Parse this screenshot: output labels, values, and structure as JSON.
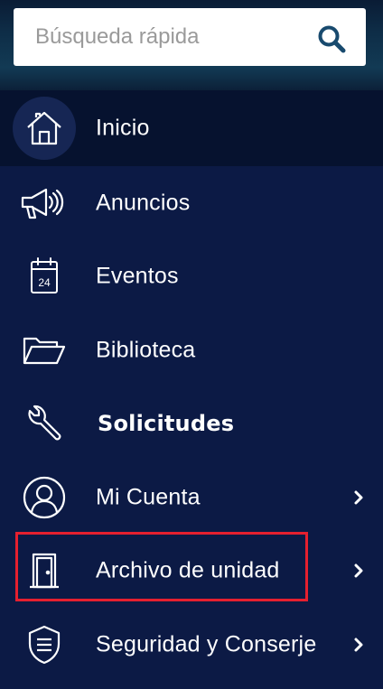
{
  "search": {
    "placeholder": "Búsqueda rápida",
    "icon": "search-icon"
  },
  "colors": {
    "background": "#0c1a45",
    "active_item": "#06122f",
    "search_icon": "#184a6e",
    "highlight_border": "#e6202f"
  },
  "menu": {
    "items": [
      {
        "label": "Inicio",
        "icon": "home-icon",
        "active": true,
        "has_submenu": false
      },
      {
        "label": "Anuncios",
        "icon": "megaphone-icon",
        "active": false,
        "has_submenu": false
      },
      {
        "label": "Eventos",
        "icon": "calendar-icon",
        "icon_text": "24",
        "active": false,
        "has_submenu": false
      },
      {
        "label": "Biblioteca",
        "icon": "folder-icon",
        "active": false,
        "has_submenu": false
      },
      {
        "label": "Solicitudes",
        "icon": "wrench-icon",
        "active": false,
        "has_submenu": false
      },
      {
        "label": "Mi Cuenta",
        "icon": "user-icon",
        "active": false,
        "has_submenu": true
      },
      {
        "label": "Archivo de unidad",
        "icon": "door-icon",
        "active": false,
        "has_submenu": true,
        "highlighted": true
      },
      {
        "label": "Seguridad y Conserje",
        "icon": "shield-icon",
        "active": false,
        "has_submenu": true
      }
    ]
  }
}
